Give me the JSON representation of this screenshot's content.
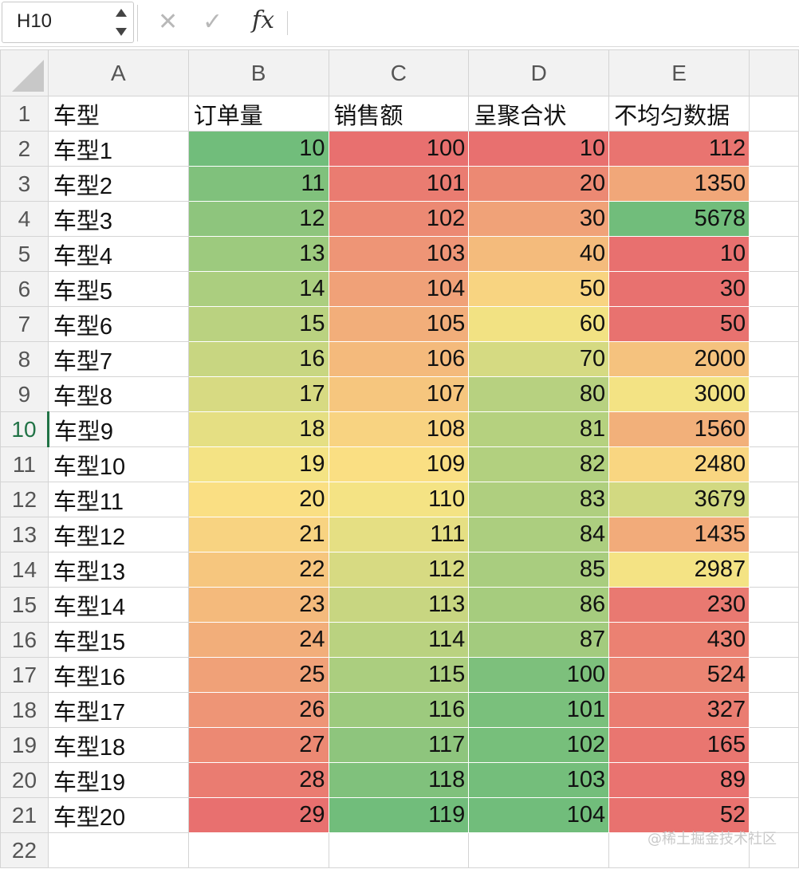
{
  "formula_bar": {
    "name_box": "H10",
    "cancel_icon": "✕",
    "enter_icon": "✓",
    "fx_label": "fx",
    "formula_value": ""
  },
  "columns": [
    "A",
    "B",
    "C",
    "D",
    "E"
  ],
  "header_row": {
    "row_number": "1",
    "cells": [
      "车型",
      "订单量",
      "销售额",
      "呈聚合状",
      "不均匀数据"
    ]
  },
  "rows": [
    {
      "row_number": "2",
      "model": "车型1",
      "orders": "10",
      "sales": "100",
      "clustered": "10",
      "uneven": "112"
    },
    {
      "row_number": "3",
      "model": "车型2",
      "orders": "11",
      "sales": "101",
      "clustered": "20",
      "uneven": "1350"
    },
    {
      "row_number": "4",
      "model": "车型3",
      "orders": "12",
      "sales": "102",
      "clustered": "30",
      "uneven": "5678"
    },
    {
      "row_number": "5",
      "model": "车型4",
      "orders": "13",
      "sales": "103",
      "clustered": "40",
      "uneven": "10"
    },
    {
      "row_number": "6",
      "model": "车型5",
      "orders": "14",
      "sales": "104",
      "clustered": "50",
      "uneven": "30"
    },
    {
      "row_number": "7",
      "model": "车型6",
      "orders": "15",
      "sales": "105",
      "clustered": "60",
      "uneven": "50"
    },
    {
      "row_number": "8",
      "model": "车型7",
      "orders": "16",
      "sales": "106",
      "clustered": "70",
      "uneven": "2000"
    },
    {
      "row_number": "9",
      "model": "车型8",
      "orders": "17",
      "sales": "107",
      "clustered": "80",
      "uneven": "3000"
    },
    {
      "row_number": "10",
      "model": "车型9",
      "orders": "18",
      "sales": "108",
      "clustered": "81",
      "uneven": "1560"
    },
    {
      "row_number": "11",
      "model": "车型10",
      "orders": "19",
      "sales": "109",
      "clustered": "82",
      "uneven": "2480"
    },
    {
      "row_number": "12",
      "model": "车型11",
      "orders": "20",
      "sales": "110",
      "clustered": "83",
      "uneven": "3679"
    },
    {
      "row_number": "13",
      "model": "车型12",
      "orders": "21",
      "sales": "111",
      "clustered": "84",
      "uneven": "1435"
    },
    {
      "row_number": "14",
      "model": "车型13",
      "orders": "22",
      "sales": "112",
      "clustered": "85",
      "uneven": "2987"
    },
    {
      "row_number": "15",
      "model": "车型14",
      "orders": "23",
      "sales": "113",
      "clustered": "86",
      "uneven": "230"
    },
    {
      "row_number": "16",
      "model": "车型15",
      "orders": "24",
      "sales": "114",
      "clustered": "87",
      "uneven": "430"
    },
    {
      "row_number": "17",
      "model": "车型16",
      "orders": "25",
      "sales": "115",
      "clustered": "100",
      "uneven": "524"
    },
    {
      "row_number": "18",
      "model": "车型17",
      "orders": "26",
      "sales": "116",
      "clustered": "101",
      "uneven": "327"
    },
    {
      "row_number": "19",
      "model": "车型18",
      "orders": "27",
      "sales": "117",
      "clustered": "102",
      "uneven": "165"
    },
    {
      "row_number": "20",
      "model": "车型19",
      "orders": "28",
      "sales": "118",
      "clustered": "103",
      "uneven": "89"
    },
    {
      "row_number": "21",
      "model": "车型20",
      "orders": "29",
      "sales": "119",
      "clustered": "104",
      "uneven": "52"
    }
  ],
  "empty_row_number": "22",
  "active_row": "10",
  "color_scales": {
    "orders": "low-green-high-red",
    "sales": "low-red-high-green",
    "clustered": "low-red-high-green",
    "uneven": "low-red-high-green"
  },
  "colors": {
    "red": "#e8706f",
    "yellow": "#fbe584",
    "green": "#71bd7b",
    "header_bg": "#f2f2f2",
    "gridline": "#d4d4d4",
    "active_row_header": "#217346"
  },
  "watermark": "@稀土掘金技术社区"
}
